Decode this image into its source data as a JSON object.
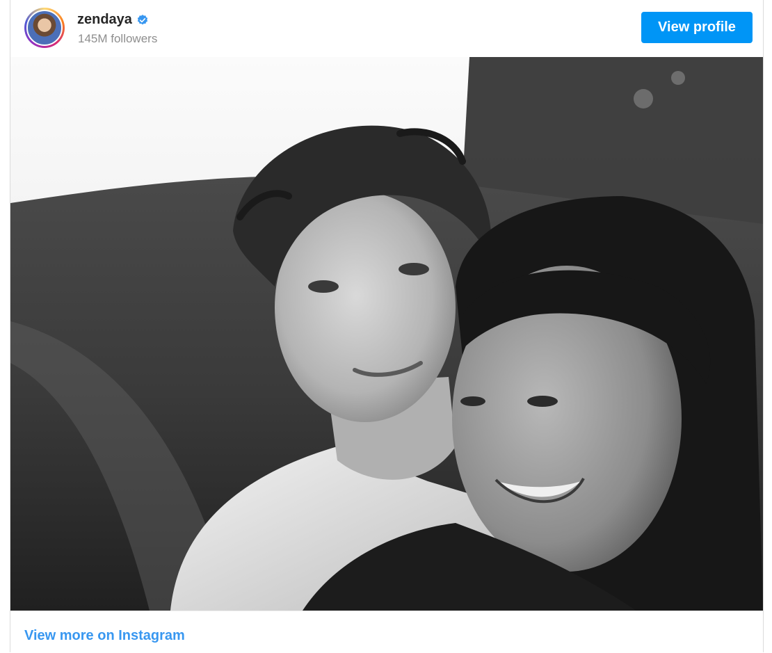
{
  "header": {
    "username": "zendaya",
    "followers": "145M followers",
    "view_profile_label": "View profile",
    "verified_icon": "verified-badge-icon"
  },
  "photo": {
    "style": "black-and-white",
    "subject": "photo"
  },
  "footer": {
    "view_more_label": "View more on Instagram"
  },
  "colors": {
    "accent": "#0095f6",
    "link": "#3897f0",
    "verified": "#3897f0",
    "secondary_text": "#8e8e8e"
  }
}
